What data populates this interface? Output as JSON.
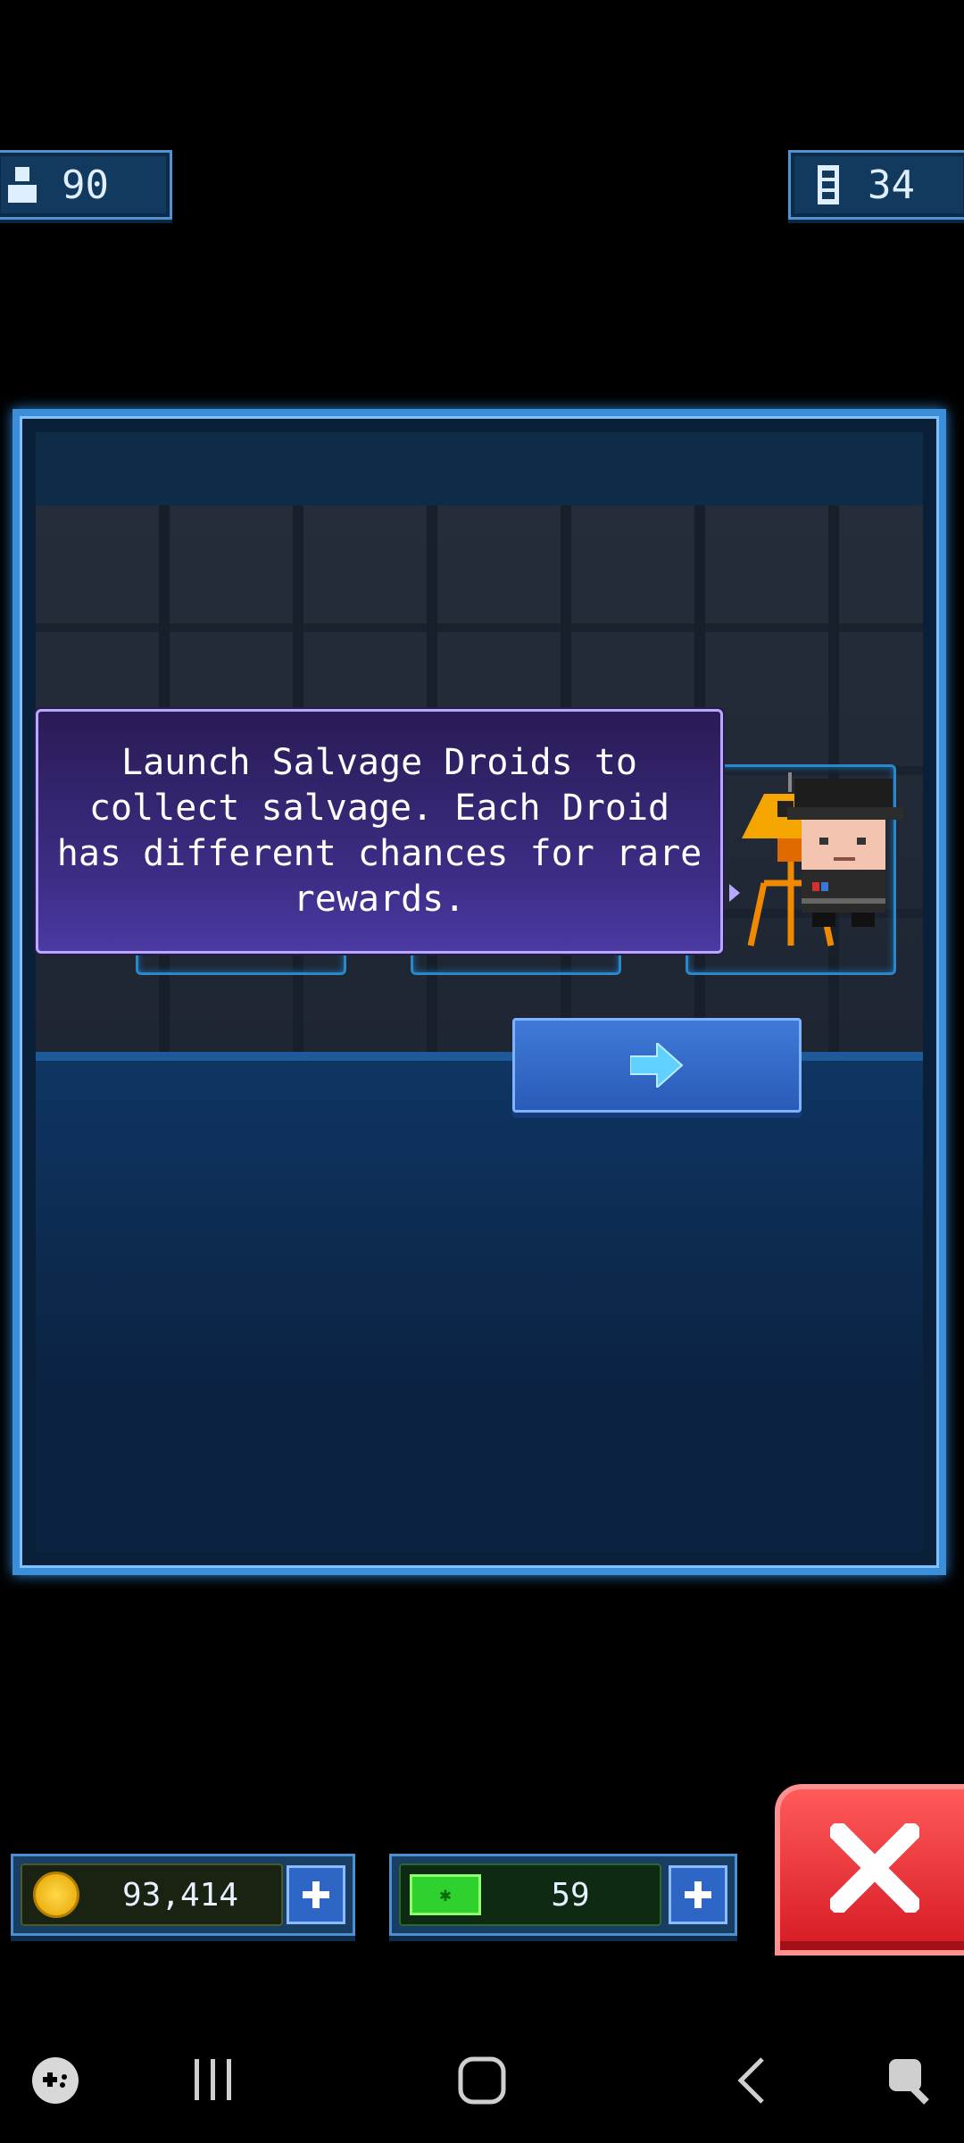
{
  "top_counters": {
    "population": "90",
    "rooms": "34"
  },
  "dialog": {
    "message": "Launch Salvage Droids to collect salvage. Each Droid has different chances for rare rewards."
  },
  "droids": [
    {
      "name": "bronze-droid",
      "color": "#a9764a"
    },
    {
      "name": "silver-droid",
      "color": "#8a8a8a"
    },
    {
      "name": "gold-droid",
      "color": "#f5a500"
    }
  ],
  "currency": {
    "coins": "93,414",
    "bux": "59"
  },
  "colors": {
    "accent": "#3d8ed8",
    "close": "#e0202a",
    "speech": "#3e2d86"
  },
  "navbar": {
    "icons": [
      "game-launcher-icon",
      "recent-apps-icon",
      "home-icon",
      "back-icon",
      "assistant-icon"
    ]
  }
}
